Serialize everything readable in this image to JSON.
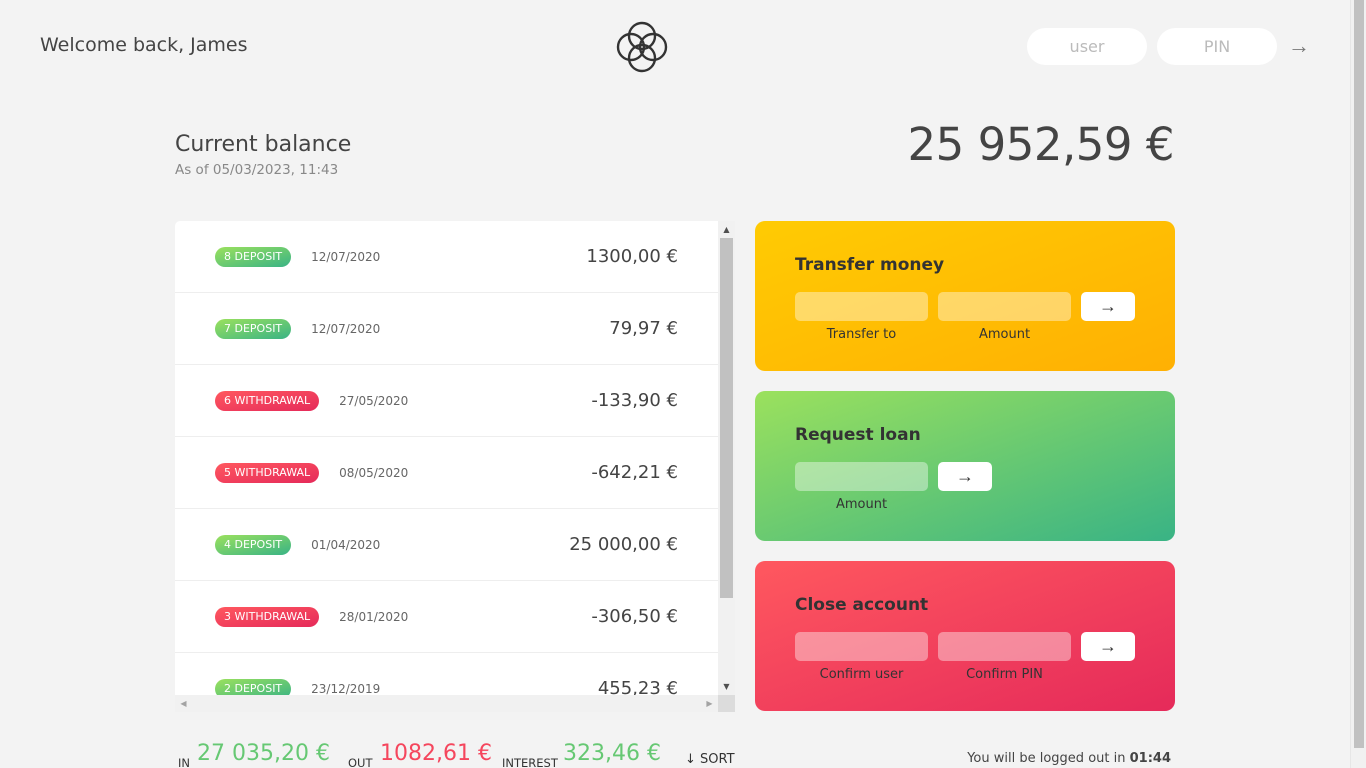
{
  "nav": {
    "welcome": "Welcome back, James",
    "user_placeholder": "user",
    "pin_placeholder": "PIN",
    "login_arrow": "→"
  },
  "balance": {
    "label": "Current balance",
    "date_prefix": "As of",
    "date": "05/03/2023, 11:43",
    "value": "25 952,59 €"
  },
  "movements": [
    {
      "type": "8 deposit",
      "kind": "deposit",
      "date": "12/07/2020",
      "value": "1300,00 €"
    },
    {
      "type": "7 deposit",
      "kind": "deposit",
      "date": "12/07/2020",
      "value": "79,97 €"
    },
    {
      "type": "6 withdrawal",
      "kind": "withdrawal",
      "date": "27/05/2020",
      "value": "-133,90 €"
    },
    {
      "type": "5 withdrawal",
      "kind": "withdrawal",
      "date": "08/05/2020",
      "value": "-642,21 €"
    },
    {
      "type": "4 deposit",
      "kind": "deposit",
      "date": "01/04/2020",
      "value": "25 000,00 €"
    },
    {
      "type": "3 withdrawal",
      "kind": "withdrawal",
      "date": "28/01/2020",
      "value": "-306,50 €"
    },
    {
      "type": "2 deposit",
      "kind": "deposit",
      "date": "23/12/2019",
      "value": "455,23 €"
    }
  ],
  "operations": {
    "transfer": {
      "title": "Transfer money",
      "label_to": "Transfer to",
      "label_amount": "Amount",
      "button": "→"
    },
    "loan": {
      "title": "Request loan",
      "label_amount": "Amount",
      "button": "→"
    },
    "close": {
      "title": "Close account",
      "label_user": "Confirm user",
      "label_pin": "Confirm PIN",
      "button": "→"
    }
  },
  "summary": {
    "in_label": "In",
    "in_value": "27 035,20 €",
    "out_label": "Out",
    "out_value": "1082,61 €",
    "interest_label": "Interest",
    "interest_value": "323,46 €",
    "sort": "↓ SORT"
  },
  "logout": {
    "text": "You will be logged out in",
    "timer": "01:44"
  },
  "colors": {
    "deposit": "#66c873",
    "withdrawal": "#f5465d",
    "transfer": "#ffbb03",
    "background": "#f3f3f3"
  }
}
